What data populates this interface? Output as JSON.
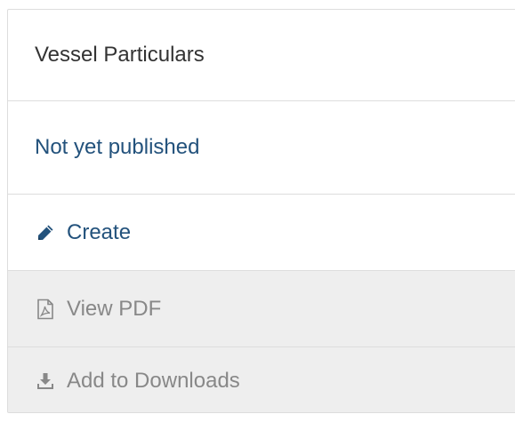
{
  "panel": {
    "title": "Vessel Particulars",
    "status": "Not yet published",
    "actions": [
      {
        "label": "Create",
        "icon": "pencil-icon",
        "enabled": true
      },
      {
        "label": "View PDF",
        "icon": "pdf-file-icon",
        "enabled": false
      },
      {
        "label": "Add to Downloads",
        "icon": "download-icon",
        "enabled": false
      }
    ]
  },
  "colors": {
    "link": "#23527c",
    "text": "#333333",
    "disabled_text": "#888888",
    "disabled_bg": "#eeeeee",
    "border": "#dddddd"
  }
}
